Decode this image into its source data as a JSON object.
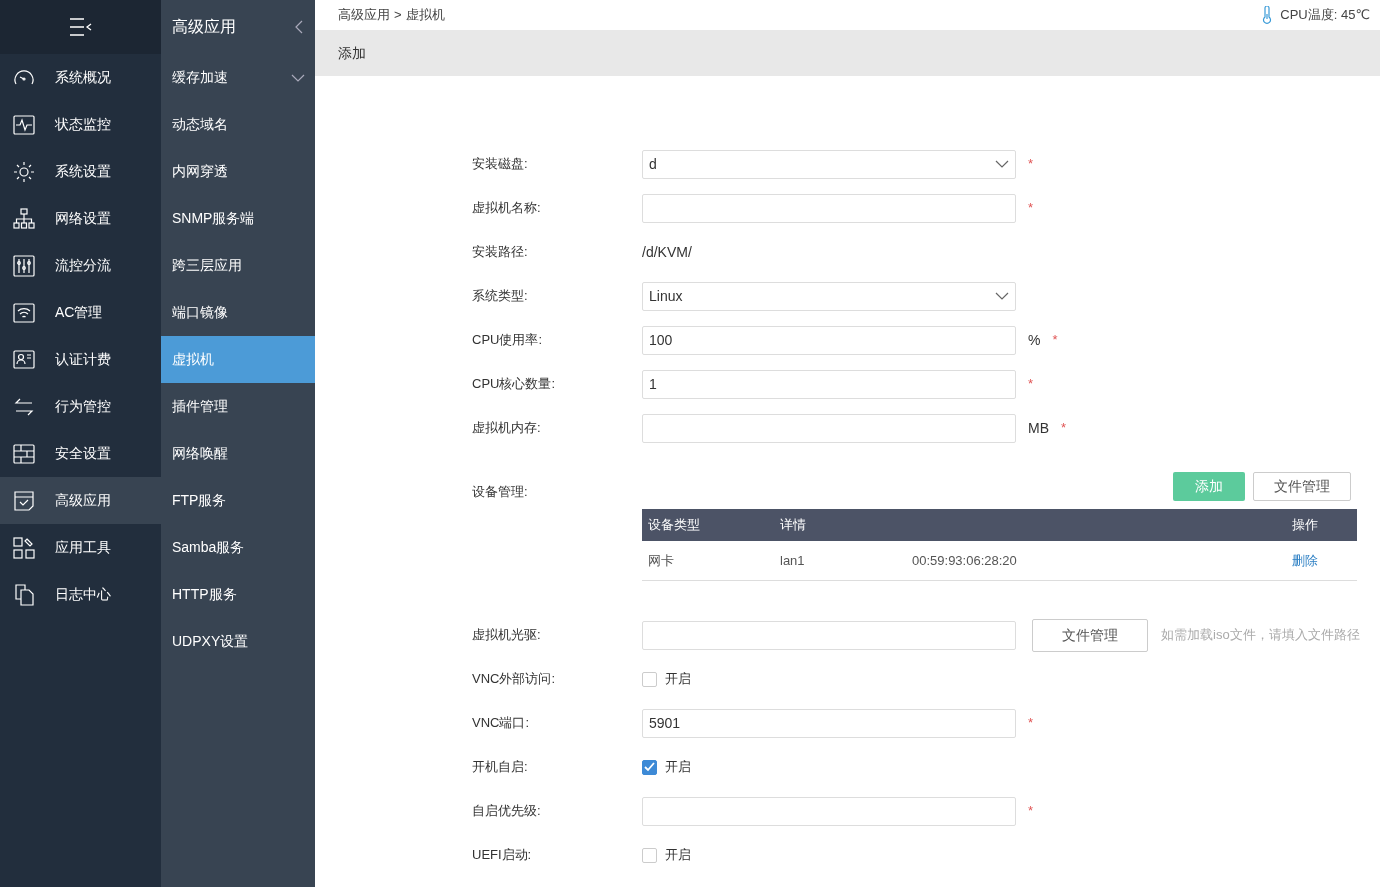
{
  "sidebar": {
    "items": [
      {
        "label": "系统概况",
        "selected": false
      },
      {
        "label": "状态监控",
        "selected": false
      },
      {
        "label": "系统设置",
        "selected": false
      },
      {
        "label": "网络设置",
        "selected": false
      },
      {
        "label": "流控分流",
        "selected": false
      },
      {
        "label": "AC管理",
        "selected": false
      },
      {
        "label": "认证计费",
        "selected": false
      },
      {
        "label": "行为管控",
        "selected": false
      },
      {
        "label": "安全设置",
        "selected": false
      },
      {
        "label": "高级应用",
        "selected": true
      },
      {
        "label": "应用工具",
        "selected": false
      },
      {
        "label": "日志中心",
        "selected": false
      }
    ]
  },
  "submenu": {
    "title": "高级应用",
    "items": [
      {
        "label": "缓存加速",
        "selected": false,
        "expanded": false
      },
      {
        "label": "动态域名",
        "selected": false
      },
      {
        "label": "内网穿透",
        "selected": false
      },
      {
        "label": "SNMP服务端",
        "selected": false
      },
      {
        "label": "跨三层应用",
        "selected": false
      },
      {
        "label": "端口镜像",
        "selected": false
      },
      {
        "label": "虚拟机",
        "selected": true
      },
      {
        "label": "插件管理",
        "selected": false
      },
      {
        "label": "网络唤醒",
        "selected": false
      },
      {
        "label": "FTP服务",
        "selected": false
      },
      {
        "label": "Samba服务",
        "selected": false
      },
      {
        "label": "HTTP服务",
        "selected": false
      },
      {
        "label": "UDPXY设置",
        "selected": false
      }
    ]
  },
  "breadcrumb": [
    "高级应用",
    "虚拟机"
  ],
  "breadcrumb_separator": ">",
  "cpu_temp": "CPU温度: 45℃",
  "section_title": "添加",
  "form": {
    "fields": [
      {
        "kind": "select",
        "label": "安装磁盘:",
        "value": "d",
        "required_mark": "*"
      },
      {
        "kind": "text",
        "label": "虚拟机名称:",
        "required_mark": "*"
      },
      {
        "kind": "static",
        "label": "安装路径:",
        "value": "/d/KVM/"
      },
      {
        "kind": "select",
        "label": "系统类型:",
        "value": "Linux"
      },
      {
        "kind": "text",
        "label": "CPU使用率:",
        "value": "100",
        "unit": "%",
        "required_mark": "*"
      },
      {
        "kind": "text",
        "label": "CPU核心数量:",
        "value": "1",
        "required_mark": "*"
      },
      {
        "kind": "text",
        "label": "虚拟机内存:",
        "unit": "MB",
        "required_mark": "*"
      },
      {
        "kind": "devices",
        "label": "设备管理:",
        "buttons": [
          {
            "label": "添加",
            "primary": true
          },
          {
            "label": "文件管理",
            "primary": false
          }
        ],
        "table": {
          "columns": [
            "设备类型",
            "详情",
            "操作"
          ],
          "rows": [
            {
              "cells": [
                "网卡",
                "lan1",
                "00:59:93:06:28:20"
              ],
              "action": "删除"
            }
          ]
        }
      },
      {
        "kind": "file",
        "label": "虚拟机光驱:",
        "button": "文件管理",
        "hint": "如需加载iso文件，请填入文件路径"
      },
      {
        "kind": "check",
        "label": "VNC外部访问:",
        "checked": false,
        "text": "开启"
      },
      {
        "kind": "text",
        "label": "VNC端口:",
        "value": "5901",
        "required_mark": "*"
      },
      {
        "kind": "check",
        "label": "开机自启:",
        "checked": true,
        "text": "开启"
      },
      {
        "kind": "text",
        "label": "自启优先级:",
        "required_mark": "*"
      },
      {
        "kind": "check",
        "label": "UEFI启动:",
        "checked": false,
        "text": "开启"
      }
    ]
  }
}
